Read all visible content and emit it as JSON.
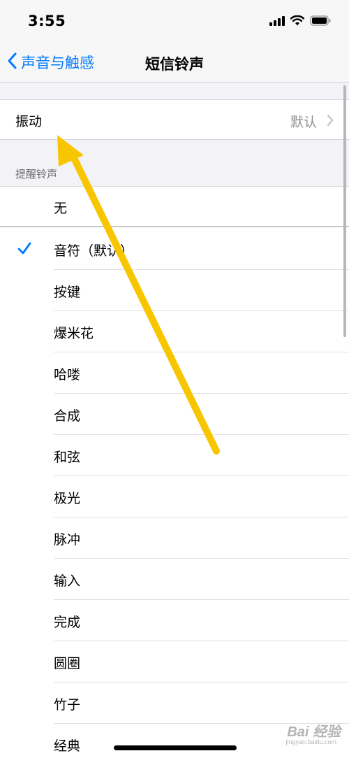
{
  "status_bar": {
    "time": "3:55"
  },
  "nav": {
    "back_label": "声音与触感",
    "title": "短信铃声"
  },
  "vibration": {
    "label": "振动",
    "value": "默认"
  },
  "section_header": "提醒铃声",
  "tones": [
    {
      "label": "无",
      "selected": false
    },
    {
      "label": "音符（默认）",
      "selected": true
    },
    {
      "label": "按键",
      "selected": false
    },
    {
      "label": "爆米花",
      "selected": false
    },
    {
      "label": "哈喽",
      "selected": false
    },
    {
      "label": "合成",
      "selected": false
    },
    {
      "label": "和弦",
      "selected": false
    },
    {
      "label": "极光",
      "selected": false
    },
    {
      "label": "脉冲",
      "selected": false
    },
    {
      "label": "输入",
      "selected": false
    },
    {
      "label": "完成",
      "selected": false
    },
    {
      "label": "圆圈",
      "selected": false
    },
    {
      "label": "竹子",
      "selected": false
    },
    {
      "label": "经典",
      "selected": false
    }
  ],
  "watermark": {
    "brand": "Bai 经验",
    "sub": "jingyan.baidu.com"
  },
  "colors": {
    "accent": "#007aff",
    "annotation_arrow": "#f7c600"
  }
}
